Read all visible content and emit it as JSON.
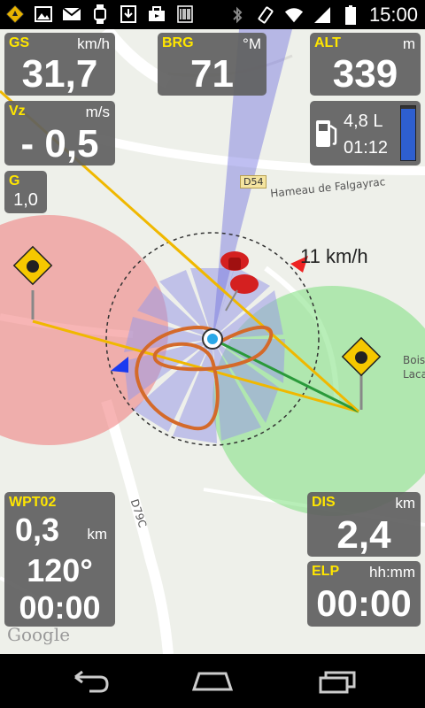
{
  "status_bar": {
    "time": "15:00",
    "left_icons": [
      "gps-app-icon",
      "image-icon",
      "gmail-icon",
      "watch-icon",
      "download-icon",
      "briefcase-icon",
      "barcode-icon"
    ],
    "right_icons": [
      "bluetooth-icon",
      "vibrate-icon",
      "wifi-icon",
      "signal-icon",
      "battery-icon"
    ]
  },
  "panels": {
    "gs": {
      "label": "GS",
      "unit": "km/h",
      "value": "31,7"
    },
    "brg": {
      "label": "BRG",
      "unit": "°M",
      "value": "71"
    },
    "alt": {
      "label": "ALT",
      "unit": "m",
      "value": "339"
    },
    "vz": {
      "label": "Vz",
      "unit": "m/s",
      "value": "- 0,5"
    },
    "fuel": {
      "amount": "4,8 L",
      "time": "01:12",
      "level": 0.95
    },
    "g": {
      "label": "G",
      "value": "1,0"
    },
    "wpt": {
      "label": "WPT02",
      "distance": "0,3",
      "distance_unit": "km",
      "bearing": "120°",
      "time": "00:00"
    },
    "dis": {
      "label": "DIS",
      "unit": "km",
      "value": "2,4"
    },
    "elp": {
      "label": "ELP",
      "unit": "hh:mm",
      "value": "00:00"
    }
  },
  "map": {
    "road_tag": "D54",
    "place_name": "Hameau de Falgayrac",
    "road_d79c": "D79C",
    "bois_label_1": "Bois",
    "bois_label_2": "Laca",
    "wind_speed": "11 km/h",
    "google_logo": "Google"
  },
  "colors": {
    "panel_label": "#ffe600",
    "red_zone": "#f07878",
    "green_zone": "#7ee07e",
    "track": "#d46a2a",
    "course_line": "#f0b800"
  }
}
